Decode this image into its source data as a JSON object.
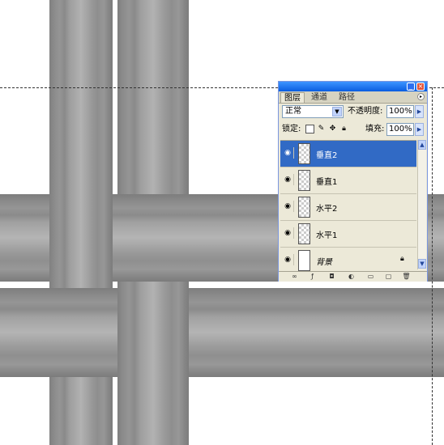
{
  "panel": {
    "tabs": [
      "图层",
      "通道",
      "路径"
    ],
    "blend_mode": "正常",
    "opacity_label": "不透明度:",
    "opacity_value": "100%",
    "lock_label": "锁定:",
    "fill_label": "填充:",
    "fill_value": "100%",
    "layers": [
      {
        "name": "垂直2",
        "selected": true
      },
      {
        "name": "垂直1",
        "selected": false
      },
      {
        "name": "水平2",
        "selected": false
      },
      {
        "name": "水平1",
        "selected": false
      },
      {
        "name": "背景",
        "selected": false,
        "locked": true
      }
    ]
  },
  "icons": {
    "minimize": "minimize-icon",
    "close": "close-icon",
    "panel_menu": "panel-menu-icon",
    "eye": "eye-icon",
    "lock": "lock-icon",
    "link": "link-layers-icon",
    "style": "layer-style-icon",
    "mask": "layer-mask-icon",
    "adjust": "adjustment-layer-icon",
    "group": "new-group-icon",
    "new": "new-layer-icon",
    "trash": "delete-layer-icon"
  }
}
